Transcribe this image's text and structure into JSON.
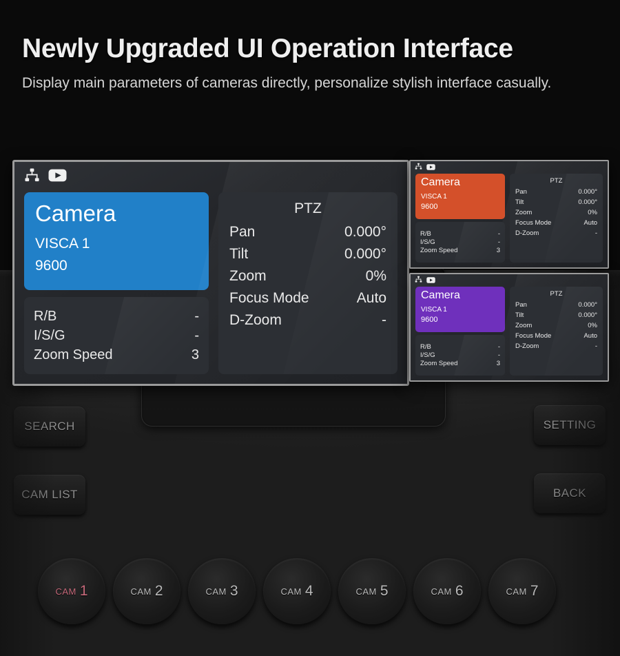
{
  "hero": {
    "title": "Newly Upgraded UI Operation Interface",
    "subtitle": "Display main parameters of cameras directly, personalize stylish interface casually."
  },
  "colors": {
    "accent_blue": "#2180c8",
    "accent_orange": "#d4502a",
    "accent_purple": "#6f30bc",
    "panel_bg": "#26292e",
    "card_bg": "#2c2f34",
    "panel_border": "#9b9b9b",
    "cam1_active": "#c6697a"
  },
  "icons": {
    "network": "network-icon",
    "video": "video-icon"
  },
  "camera_card": {
    "title": "Camera",
    "protocol": "VISCA 1",
    "baud": "9600"
  },
  "info_rows": [
    {
      "key": "R/B",
      "value": "-"
    },
    {
      "key": "I/S/G",
      "value": "-"
    },
    {
      "key": "Zoom Speed",
      "value": "3"
    }
  ],
  "ptz": {
    "title": "PTZ",
    "rows": [
      {
        "key": "Pan",
        "value": "0.000°"
      },
      {
        "key": "Tilt",
        "value": "0.000°"
      },
      {
        "key": "Zoom",
        "value": "0%"
      },
      {
        "key": "Focus Mode",
        "value": "Auto"
      },
      {
        "key": "D-Zoom",
        "value": "-"
      }
    ]
  },
  "panels": [
    {
      "id": "panel-main",
      "theme": "blue",
      "accent": "#2180c8"
    },
    {
      "id": "panel-orange",
      "theme": "orange",
      "accent": "#d4502a"
    },
    {
      "id": "panel-purple",
      "theme": "purple",
      "accent": "#6f30bc"
    }
  ],
  "device": {
    "buttons": {
      "search": "SEARCH",
      "cam_list": "CAM LIST",
      "setting": "SETTING",
      "back": "BACK"
    },
    "cam_buttons": [
      {
        "word": "CAM",
        "num": "1",
        "active": true
      },
      {
        "word": "CAM",
        "num": "2",
        "active": false
      },
      {
        "word": "CAM",
        "num": "3",
        "active": false
      },
      {
        "word": "CAM",
        "num": "4",
        "active": false
      },
      {
        "word": "CAM",
        "num": "5",
        "active": false
      },
      {
        "word": "CAM",
        "num": "6",
        "active": false
      },
      {
        "word": "CAM",
        "num": "7",
        "active": false
      }
    ]
  }
}
